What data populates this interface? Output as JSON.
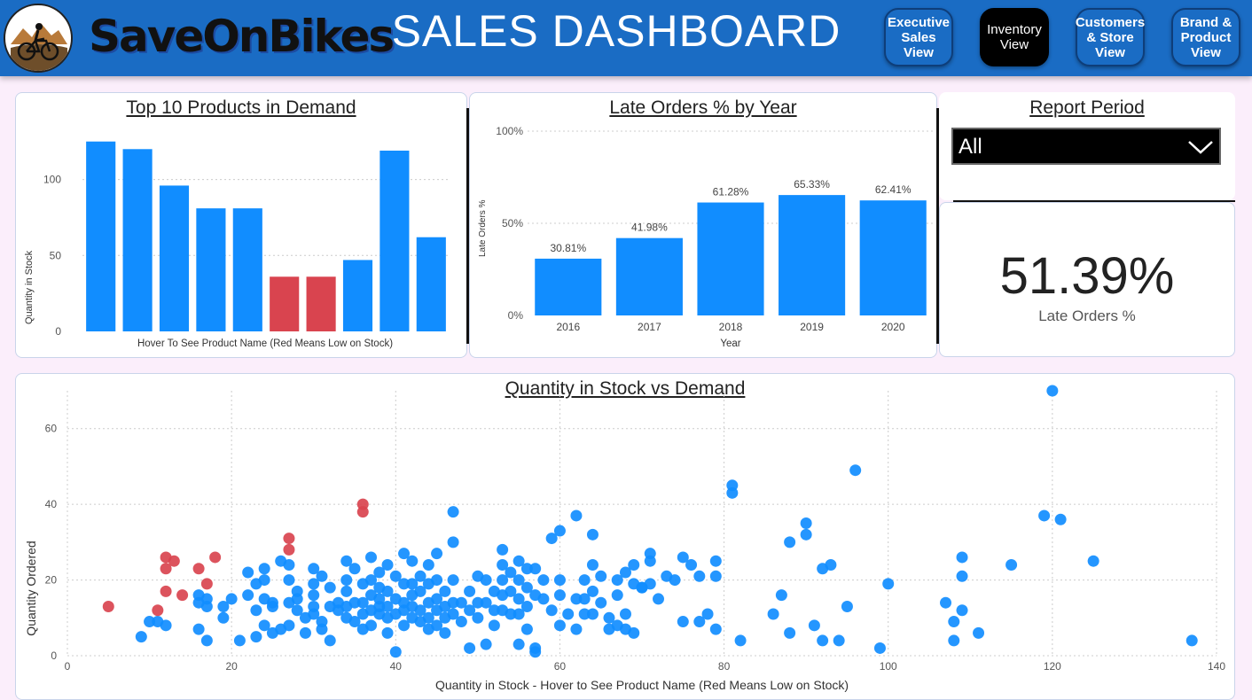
{
  "header": {
    "brand": "SaveOnBikes",
    "title": "SALES DASHBOARD",
    "nav": [
      {
        "label_lines": [
          "Executive",
          "Sales View"
        ],
        "active": false
      },
      {
        "label_lines": [
          "Inventory",
          "View"
        ],
        "active": true
      },
      {
        "label_lines": [
          "Customers",
          "& Store",
          "View"
        ],
        "active": false
      },
      {
        "label_lines": [
          "Brand &",
          "Product",
          "View"
        ],
        "active": false
      }
    ]
  },
  "top_products": {
    "title": "Top 10 Products in Demand",
    "xlabel": "Hover To See Product Name (Red Means Low on Stock)",
    "ylabel": "Quantity in Stock"
  },
  "late_orders": {
    "title": "Late Orders % by Year",
    "xlabel": "Year",
    "ylabel": "Late Orders %"
  },
  "report_period": {
    "title": "Report Period",
    "selected": "All"
  },
  "kpi": {
    "value": "51.39%",
    "label": "Late Orders %"
  },
  "scatter": {
    "title": "Quantity in Stock vs Demand",
    "xlabel": "Quantity in Stock - Hover to See Product Name (Red Means Low on Stock)",
    "ylabel": "Quantity Ordered"
  },
  "colors": {
    "header": "#1a6cc4",
    "bar_normal": "#118dff",
    "bar_low": "#d9444f"
  },
  "chart_data": [
    {
      "type": "bar",
      "id": "top_products",
      "categories": [
        "",
        "",
        "",
        "",
        "",
        "",
        "",
        "",
        "",
        ""
      ],
      "values": [
        125,
        120,
        96,
        81,
        81,
        36,
        36,
        47,
        119,
        62
      ],
      "low_stock": [
        false,
        false,
        false,
        false,
        false,
        true,
        true,
        false,
        false,
        false
      ],
      "ylim": [
        0,
        140
      ],
      "yticks": [
        0,
        50,
        100
      ],
      "grid": true
    },
    {
      "type": "bar",
      "id": "late_orders",
      "categories": [
        "2016",
        "2017",
        "2018",
        "2019",
        "2020"
      ],
      "values": [
        30.81,
        41.98,
        61.28,
        65.33,
        62.41
      ],
      "data_labels": [
        "30.81%",
        "41.98%",
        "61.28%",
        "65.33%",
        "62.41%"
      ],
      "ylim": [
        0,
        100
      ],
      "yticks": [
        0,
        50,
        100
      ],
      "ytick_labels": [
        "0%",
        "50%",
        "100%"
      ],
      "grid": true
    },
    {
      "type": "scatter",
      "id": "scatter",
      "xlim": [
        0,
        140
      ],
      "ylim": [
        0,
        70
      ],
      "xticks": [
        0,
        20,
        40,
        60,
        80,
        100,
        120,
        140
      ],
      "yticks": [
        0,
        20,
        40,
        60
      ],
      "grid": true,
      "low_points": [
        [
          5,
          13
        ],
        [
          11,
          12
        ],
        [
          12,
          26
        ],
        [
          12,
          23
        ],
        [
          12,
          17
        ],
        [
          13,
          25
        ],
        [
          14,
          16
        ],
        [
          16,
          23
        ],
        [
          17,
          19
        ],
        [
          18,
          26
        ],
        [
          27,
          31
        ],
        [
          27,
          28
        ],
        [
          36,
          40
        ],
        [
          36,
          38
        ]
      ],
      "points": [
        [
          9,
          5
        ],
        [
          10,
          9
        ],
        [
          11,
          9
        ],
        [
          12,
          8
        ],
        [
          16,
          16
        ],
        [
          16,
          14
        ],
        [
          16,
          7
        ],
        [
          17,
          15
        ],
        [
          17,
          13
        ],
        [
          17,
          4
        ],
        [
          19,
          13
        ],
        [
          19,
          10
        ],
        [
          20,
          15
        ],
        [
          21,
          4
        ],
        [
          22,
          22
        ],
        [
          22,
          16
        ],
        [
          23,
          19
        ],
        [
          23,
          12
        ],
        [
          23,
          5
        ],
        [
          24,
          23
        ],
        [
          24,
          20
        ],
        [
          24,
          15
        ],
        [
          24,
          8
        ],
        [
          25,
          13
        ],
        [
          25,
          6
        ],
        [
          25,
          14
        ],
        [
          26,
          25
        ],
        [
          26,
          7
        ],
        [
          27,
          24
        ],
        [
          27,
          20
        ],
        [
          27,
          14
        ],
        [
          27,
          8
        ],
        [
          28,
          17
        ],
        [
          28,
          15
        ],
        [
          28,
          12
        ],
        [
          29,
          10
        ],
        [
          29,
          6
        ],
        [
          30,
          23
        ],
        [
          30,
          19
        ],
        [
          30,
          16
        ],
        [
          30,
          13
        ],
        [
          30,
          11
        ],
        [
          31,
          21
        ],
        [
          31,
          9
        ],
        [
          31,
          7
        ],
        [
          32,
          18
        ],
        [
          32,
          13
        ],
        [
          32,
          4
        ],
        [
          33,
          14
        ],
        [
          33,
          12
        ],
        [
          34,
          25
        ],
        [
          34,
          20
        ],
        [
          34,
          17
        ],
        [
          34,
          13
        ],
        [
          34,
          10
        ],
        [
          35,
          23
        ],
        [
          35,
          14
        ],
        [
          35,
          9
        ],
        [
          36,
          19
        ],
        [
          36,
          14
        ],
        [
          36,
          11
        ],
        [
          36,
          7
        ],
        [
          37,
          26
        ],
        [
          37,
          20
        ],
        [
          37,
          16
        ],
        [
          37,
          12
        ],
        [
          37,
          8
        ],
        [
          38,
          22
        ],
        [
          38,
          18
        ],
        [
          38,
          15
        ],
        [
          38,
          13
        ],
        [
          38,
          11
        ],
        [
          39,
          24
        ],
        [
          39,
          17
        ],
        [
          39,
          13
        ],
        [
          39,
          10
        ],
        [
          39,
          6
        ],
        [
          40,
          21
        ],
        [
          40,
          15
        ],
        [
          40,
          11
        ],
        [
          40,
          1
        ],
        [
          41,
          27
        ],
        [
          41,
          19
        ],
        [
          41,
          14
        ],
        [
          41,
          12
        ],
        [
          41,
          8
        ],
        [
          42,
          25
        ],
        [
          42,
          19
        ],
        [
          42,
          16
        ],
        [
          42,
          13
        ],
        [
          42,
          10
        ],
        [
          43,
          21
        ],
        [
          43,
          17
        ],
        [
          43,
          12
        ],
        [
          43,
          9
        ],
        [
          44,
          24
        ],
        [
          44,
          19
        ],
        [
          44,
          14
        ],
        [
          44,
          10
        ],
        [
          44,
          7
        ],
        [
          45,
          27
        ],
        [
          45,
          20
        ],
        [
          45,
          15
        ],
        [
          45,
          12
        ],
        [
          45,
          8
        ],
        [
          46,
          17
        ],
        [
          46,
          13
        ],
        [
          46,
          10
        ],
        [
          46,
          6
        ],
        [
          47,
          38
        ],
        [
          47,
          30
        ],
        [
          47,
          20
        ],
        [
          47,
          14
        ],
        [
          47,
          11
        ],
        [
          48,
          14
        ],
        [
          48,
          9
        ],
        [
          49,
          17
        ],
        [
          49,
          12
        ],
        [
          49,
          2
        ],
        [
          50,
          21
        ],
        [
          50,
          14
        ],
        [
          50,
          10
        ],
        [
          51,
          20
        ],
        [
          51,
          14
        ],
        [
          51,
          3
        ],
        [
          52,
          17
        ],
        [
          52,
          12
        ],
        [
          52,
          8
        ],
        [
          53,
          28
        ],
        [
          53,
          24
        ],
        [
          53,
          20
        ],
        [
          53,
          16
        ],
        [
          53,
          12
        ],
        [
          54,
          22
        ],
        [
          54,
          17
        ],
        [
          54,
          11
        ],
        [
          55,
          25
        ],
        [
          55,
          20
        ],
        [
          55,
          15
        ],
        [
          55,
          11
        ],
        [
          55,
          3
        ],
        [
          56,
          23
        ],
        [
          56,
          18
        ],
        [
          56,
          13
        ],
        [
          56,
          7
        ],
        [
          57,
          23
        ],
        [
          57,
          16
        ],
        [
          57,
          1
        ],
        [
          57,
          2
        ],
        [
          58,
          20
        ],
        [
          58,
          15
        ],
        [
          59,
          31
        ],
        [
          59,
          12
        ],
        [
          60,
          33
        ],
        [
          60,
          20
        ],
        [
          60,
          16
        ],
        [
          60,
          8
        ],
        [
          61,
          11
        ],
        [
          62,
          37
        ],
        [
          62,
          15
        ],
        [
          62,
          7
        ],
        [
          63,
          20
        ],
        [
          63,
          15
        ],
        [
          63,
          11
        ],
        [
          64,
          32
        ],
        [
          64,
          24
        ],
        [
          64,
          17
        ],
        [
          64,
          11
        ],
        [
          65,
          21
        ],
        [
          65,
          14
        ],
        [
          66,
          10
        ],
        [
          66,
          7
        ],
        [
          67,
          20
        ],
        [
          67,
          16
        ],
        [
          67,
          8
        ],
        [
          68,
          22
        ],
        [
          68,
          11
        ],
        [
          68,
          7
        ],
        [
          69,
          19
        ],
        [
          69,
          24
        ],
        [
          69,
          6
        ],
        [
          70,
          18
        ],
        [
          70,
          18
        ],
        [
          71,
          27
        ],
        [
          71,
          25
        ],
        [
          71,
          19
        ],
        [
          72,
          15
        ],
        [
          73,
          21
        ],
        [
          74,
          20
        ],
        [
          75,
          26
        ],
        [
          75,
          9
        ],
        [
          76,
          24
        ],
        [
          77,
          21
        ],
        [
          77,
          9
        ],
        [
          78,
          11
        ],
        [
          79,
          25
        ],
        [
          79,
          21
        ],
        [
          79,
          7
        ],
        [
          81,
          45
        ],
        [
          81,
          43
        ],
        [
          82,
          4
        ],
        [
          86,
          11
        ],
        [
          87,
          16
        ],
        [
          88,
          30
        ],
        [
          88,
          6
        ],
        [
          90,
          35
        ],
        [
          90,
          32
        ],
        [
          91,
          8
        ],
        [
          92,
          23
        ],
        [
          92,
          4
        ],
        [
          93,
          24
        ],
        [
          94,
          4
        ],
        [
          95,
          13
        ],
        [
          96,
          49
        ],
        [
          99,
          2
        ],
        [
          100,
          19
        ],
        [
          107,
          14
        ],
        [
          108,
          4
        ],
        [
          108,
          9
        ],
        [
          109,
          26
        ],
        [
          109,
          21
        ],
        [
          109,
          12
        ],
        [
          111,
          6
        ],
        [
          115,
          24
        ],
        [
          119,
          37
        ],
        [
          120,
          70
        ],
        [
          121,
          36
        ],
        [
          125,
          25
        ],
        [
          137,
          4
        ]
      ]
    }
  ]
}
